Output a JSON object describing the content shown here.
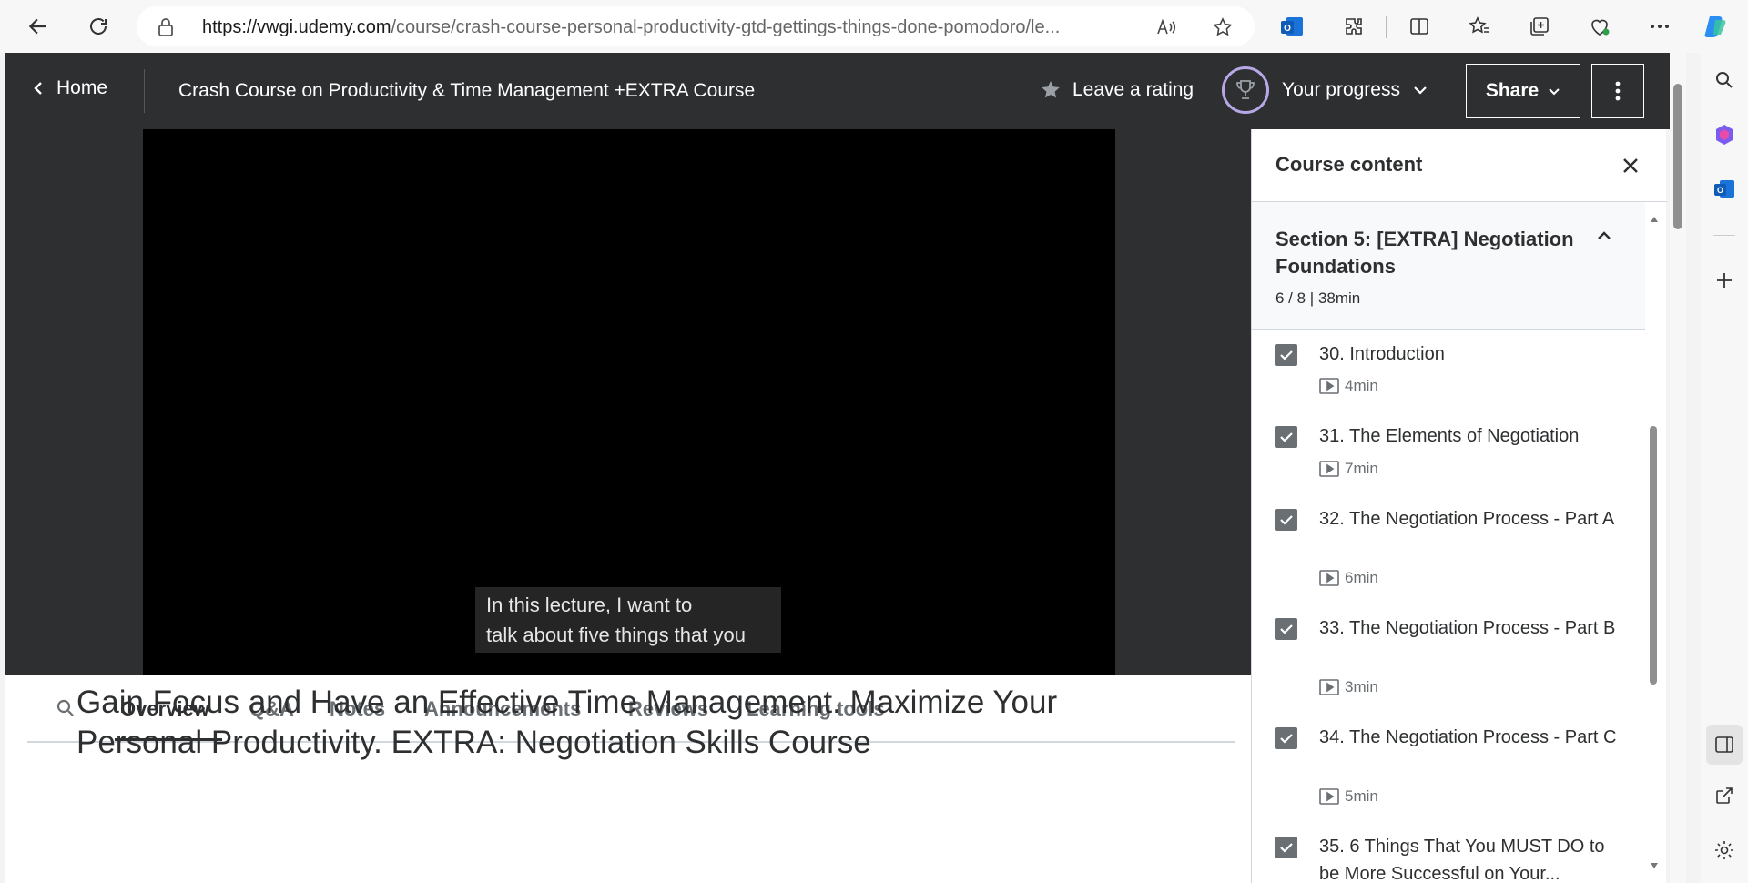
{
  "browser": {
    "url_domain": "https://vwgi.udemy.com",
    "url_path": "/course/crash-course-personal-productivity-gtd-gettings-things-done-pomodoro/le..."
  },
  "header": {
    "home_label": "Home",
    "course_title": "Crash Course on Productivity & Time Management +EXTRA Course",
    "rating_label": "Leave a rating",
    "progress_label": "Your progress",
    "share_label": "Share"
  },
  "video": {
    "caption_line1": "In this lecture, I want to",
    "caption_line2": "talk about five things that you"
  },
  "tabs": [
    {
      "label": "Overview",
      "active": true
    },
    {
      "label": "Q&A",
      "active": false
    },
    {
      "label": "Notes",
      "active": false
    },
    {
      "label": "Announcements",
      "active": false
    },
    {
      "label": "Reviews",
      "active": false
    },
    {
      "label": "Learning tools",
      "active": false
    }
  ],
  "overview": {
    "heading": "Gain Focus and Have an Effective Time Management. Maximize Your Personal Productivity. EXTRA: Negotiation Skills Course"
  },
  "course_content": {
    "title": "Course content",
    "section": {
      "title": "Section 5: [EXTRA] Negotiation Foundations",
      "meta": "6 / 8 | 38min"
    },
    "lectures": [
      {
        "title": "30. Introduction",
        "duration": "4min",
        "completed": true
      },
      {
        "title": "31. The Elements of Negotiation",
        "duration": "7min",
        "completed": true
      },
      {
        "title": "32. The Negotiation Process - Part A",
        "duration": "6min",
        "completed": true
      },
      {
        "title": "33. The Negotiation Process - Part B",
        "duration": "3min",
        "completed": true
      },
      {
        "title": "34. The Negotiation Process - Part C",
        "duration": "5min",
        "completed": true
      },
      {
        "title": "35. 6 Things That You MUST DO to be More Successful on Your...",
        "duration": "",
        "completed": true
      }
    ]
  },
  "colors": {
    "header_bg": "#2d2f31",
    "text_dark": "#2d2f31",
    "text_muted": "#6a6f73",
    "progress_ring": "#b8a8e8"
  }
}
